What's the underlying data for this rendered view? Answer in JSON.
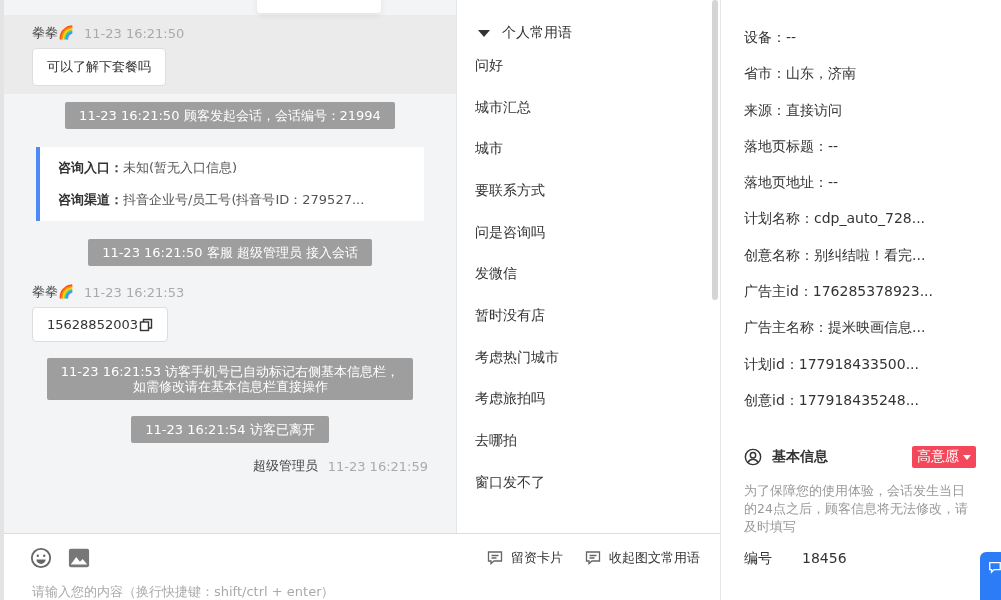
{
  "chat": {
    "messages": [
      {
        "kind": "visitor",
        "highlighted": true,
        "sender": "拳拳🌈",
        "time": "11-23 16:21:50",
        "text": "可以了解下套餐吗",
        "copyable": false
      },
      {
        "kind": "system",
        "text": "11-23 16:21:50 顾客发起会话，会话编号：21994"
      },
      {
        "kind": "info",
        "lines": [
          {
            "label": "咨询入口：",
            "value": "未知(暂无入口信息)"
          },
          {
            "label": "咨询渠道：",
            "value": "抖音企业号/员工号(抖音号ID：279527..."
          }
        ]
      },
      {
        "kind": "system",
        "text": "11-23 16:21:50 客服 超级管理员 接入会话"
      },
      {
        "kind": "visitor",
        "highlighted": false,
        "sender": "拳拳🌈",
        "time": "11-23 16:21:53",
        "text": "15628852003",
        "copyable": true
      },
      {
        "kind": "system",
        "lines": [
          "11-23 16:21:53 访客手机号已自动标记右侧基本信息栏，",
          "如需修改请在基本信息栏直接操作"
        ]
      },
      {
        "kind": "system",
        "text": "11-23 16:21:54 访客已离开"
      },
      {
        "kind": "agent",
        "sender": "超级管理员",
        "time": "11-23 16:21:59"
      }
    ]
  },
  "phrases": {
    "group": {
      "label": "个人常用语",
      "expanded": true
    },
    "items": [
      "问好",
      "城市汇总",
      "城市",
      "要联系方式",
      "问是咨询吗",
      "发微信",
      "暂时没有店",
      "考虑热门城市",
      "考虑旅拍吗",
      "去哪拍",
      "窗口发不了"
    ]
  },
  "composer": {
    "actions": [
      "留资卡片",
      "收起图文常用语"
    ],
    "placeholder": "请输入您的内容（换行快捷键：shift/ctrl + enter）"
  },
  "details": {
    "fields": [
      "设备：--",
      "省市：山东，济南",
      "来源：直接访问",
      "落地页标题：--",
      "落地页地址：--",
      "计划名称：cdp_auto_728...",
      "创意名称：别纠结啦！看完...",
      "广告主id：176285378923...",
      "广告主名称：提米映画信息...",
      "计划id：177918433500...",
      "创意id：177918435248..."
    ]
  },
  "basic_info": {
    "title": "基本信息",
    "intent": {
      "label": "高意愿",
      "color": "#f5475a"
    },
    "note": "为了保障您的使用体验，会话发生当日的24点之后，顾客信息将无法修改，请及时填写",
    "fields": [
      {
        "label": "编号",
        "value": "18456"
      }
    ]
  }
}
